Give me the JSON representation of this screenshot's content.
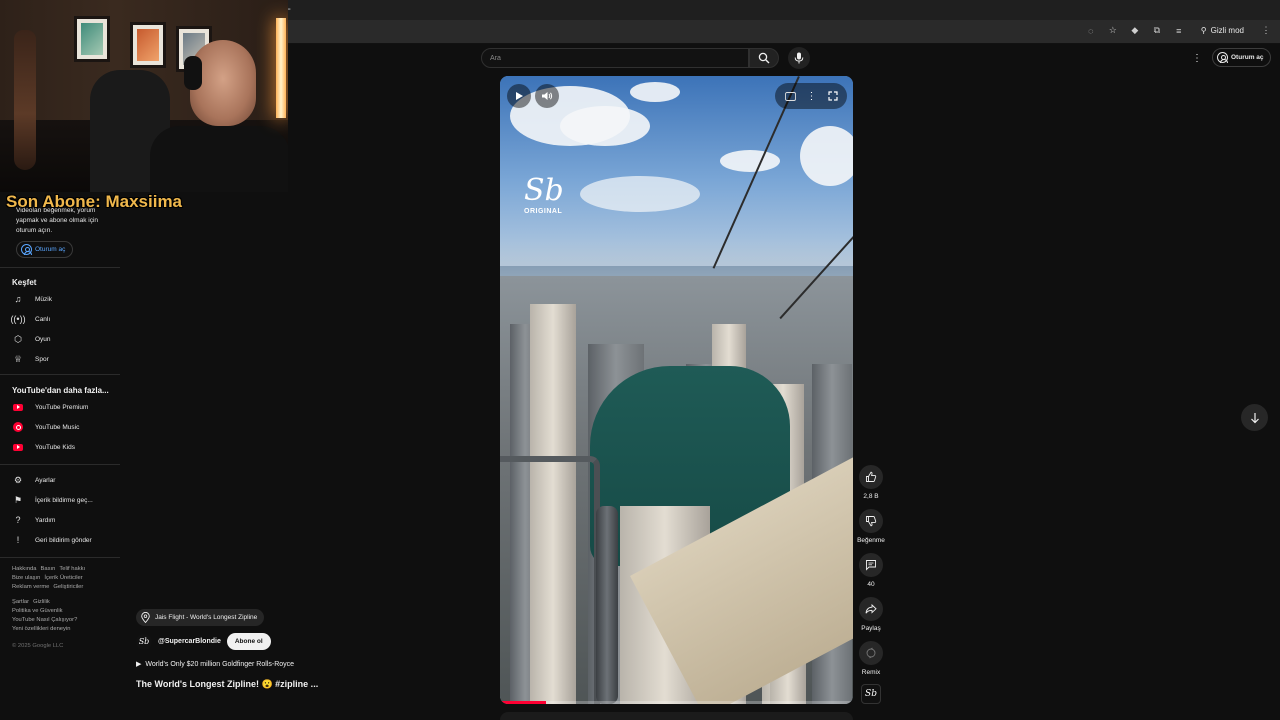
{
  "browser": {
    "incognito_label": "Gizli mod"
  },
  "stream_overlay": {
    "last_subscriber": "Son Abone: Maxsiima"
  },
  "sidebar": {
    "signin_prompt": "Videoları beğenmek, yorum yapmak ve abone olmak için oturum açın.",
    "signin_button": "Oturum aç",
    "explore_heading": "Keşfet",
    "explore_items": [
      {
        "label": "Müzik",
        "icon": "music-note-icon"
      },
      {
        "label": "Canlı",
        "icon": "live-icon"
      },
      {
        "label": "Oyun",
        "icon": "gaming-icon"
      },
      {
        "label": "Spor",
        "icon": "trophy-icon"
      }
    ],
    "more_heading": "YouTube'dan daha fazla...",
    "more_items": [
      {
        "label": "YouTube Premium",
        "icon": "youtube-premium-icon"
      },
      {
        "label": "YouTube Music",
        "icon": "youtube-music-icon"
      },
      {
        "label": "YouTube Kids",
        "icon": "youtube-kids-icon"
      }
    ],
    "settings_items": [
      {
        "label": "Ayarlar",
        "icon": "gear-icon"
      },
      {
        "label": "İçerik bildirme geç...",
        "icon": "flag-icon"
      },
      {
        "label": "Yardım",
        "icon": "help-icon"
      },
      {
        "label": "Geri bildirim gönder",
        "icon": "feedback-icon"
      }
    ],
    "footer_line1": [
      "Hakkında",
      "Basın",
      "Telif hakkı"
    ],
    "footer_line2": [
      "Bize ulaşın",
      "İçerik Üreticiler"
    ],
    "footer_line3": [
      "Reklam verme",
      "Geliştiriciler"
    ],
    "footer_line4": [
      "Şartlar",
      "Gizlilik"
    ],
    "footer_line5": "Politika ve Güvenlik",
    "footer_line6": "YouTube Nasıl Çalışıyor?",
    "footer_line7": "Yeni özellikleri deneyin",
    "copyright": "© 2025 Google LLC"
  },
  "header": {
    "search_placeholder": "Ara",
    "signin_button": "Oturum aç"
  },
  "video": {
    "watermark_text": "ORIGINAL",
    "progress_fraction": 0.13
  },
  "actions": {
    "like_count": "2,8 B",
    "dislike_label": "Beğenme",
    "comment_count": "40",
    "share_label": "Paylaş",
    "remix_label": "Remix"
  },
  "meta": {
    "location": "Jais Flight - World's Longest Zipline",
    "channel": "@SupercarBlondie",
    "subscribe": "Abone ol",
    "music": "World's Only $20 million Goldfinger Rolls-Royce",
    "title": "The World's Longest Zipline! 😮 #zipline ..."
  },
  "colors": {
    "accent_red": "#ff0033",
    "link_blue": "#5aa6ff",
    "overlay_gold": "#f0b84c"
  }
}
